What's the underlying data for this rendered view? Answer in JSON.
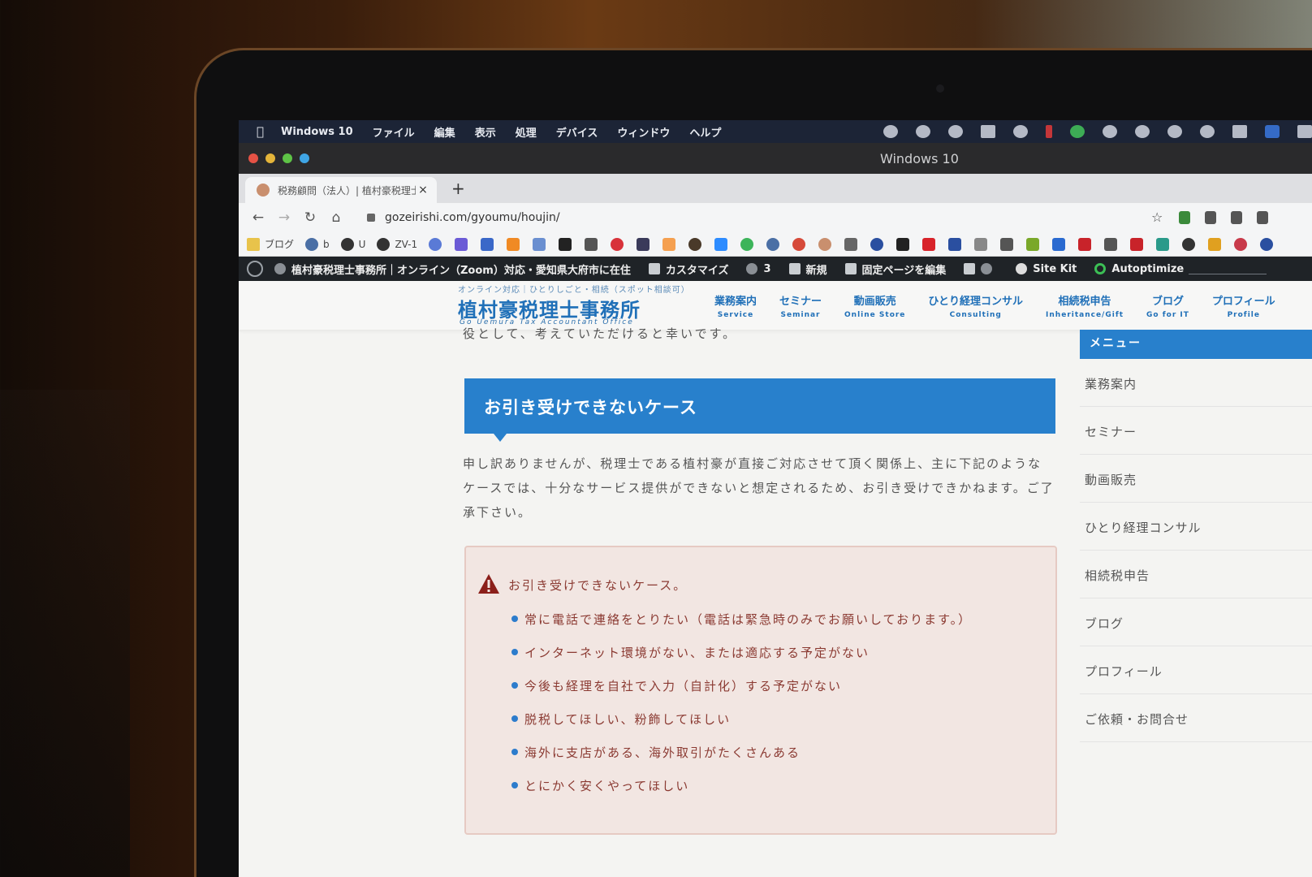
{
  "menubar": {
    "app": "Windows 10",
    "items": [
      "ファイル",
      "編集",
      "表示",
      "処理",
      "デバイス",
      "ウィンドウ",
      "ヘルプ"
    ]
  },
  "window": {
    "title": "Windows 10"
  },
  "tab": {
    "title": "税務顧問（法人）| 植村豪税理士",
    "close": "×",
    "new": "+"
  },
  "toolbar": {
    "url": "gozeirishi.com/gyoumu/houjin/"
  },
  "bookmarks": {
    "items": [
      {
        "label": "ブログ",
        "icon": "folder-icon"
      },
      {
        "label": "b",
        "icon": "wordpress-icon"
      },
      {
        "label": "U",
        "icon": "globe-icon"
      },
      {
        "label": "ZV-1",
        "icon": "globe-icon"
      }
    ]
  },
  "wpbar": {
    "site": "植村豪税理士事務所｜オンライン（Zoom）対応・愛知県大府市に在住",
    "customize": "カスタマイズ",
    "updates": "3",
    "new": "新規",
    "edit": "固定ページを編集",
    "sitekit": "Site Kit",
    "autoptimize": "Autoptimize"
  },
  "site": {
    "tagline": "オンライン対応｜ひとりしごと・相続（スポット相談可）",
    "name": "植村豪税理士事務所",
    "subname": "Go Uemura Tax Accountant Office",
    "nav": [
      {
        "jp": "業務案内",
        "en": "Service"
      },
      {
        "jp": "セミナー",
        "en": "Seminar"
      },
      {
        "jp": "動画販売",
        "en": "Online Store"
      },
      {
        "jp": "ひとり経理コンサル",
        "en": "Consulting"
      },
      {
        "jp": "相続税申告",
        "en": "Inheritance/Gift"
      },
      {
        "jp": "ブログ",
        "en": "Go for IT"
      },
      {
        "jp": "プロフィール",
        "en": "Profile"
      }
    ]
  },
  "content": {
    "top_line": "役として、考えていただけると幸いです。",
    "heading": "お引き受けできないケース",
    "paragraph": "申し訳ありませんが、税理士である植村豪が直接ご対応させて頂く関係上、主に下記のようなケースでは、十分なサービス提供ができないと想定されるため、お引き受けできかねます。ご了承下さい。",
    "alert_title": "お引き受けできないケース。",
    "alert_items": [
      "常に電話で連絡をとりたい（電話は緊急時のみでお願いしております。）",
      "インターネット環境がない、または適応する予定がない",
      "今後も経理を自社で入力（自計化）する予定がない",
      "脱税してほしい、粉飾してほしい",
      "海外に支店がある、海外取引がたくさんある",
      "とにかく安くやってほしい"
    ]
  },
  "sidebar": {
    "heading": "メニュー",
    "items": [
      "業務案内",
      "セミナー",
      "動画販売",
      "ひとり経理コンサル",
      "相続税申告",
      "ブログ",
      "プロフィール",
      "ご依頼・お問合せ"
    ]
  },
  "colors": {
    "accent": "#2880cc",
    "alert_text": "#8b3a32",
    "alert_bg": "#f2e6e2"
  }
}
